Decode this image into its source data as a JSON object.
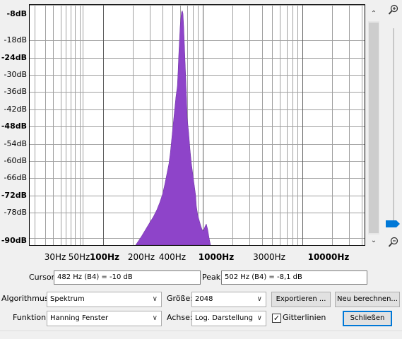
{
  "spectrum": {
    "y_axis": {
      "labels": [
        {
          "text": "-8dB",
          "bold": true
        },
        {
          "text": "-18dB",
          "bold": false
        },
        {
          "text": "-24dB",
          "bold": true
        },
        {
          "text": "-30dB",
          "bold": false
        },
        {
          "text": "-36dB",
          "bold": false
        },
        {
          "text": "-42dB",
          "bold": false
        },
        {
          "text": "-48dB",
          "bold": true
        },
        {
          "text": "-54dB",
          "bold": false
        },
        {
          "text": "-60dB",
          "bold": false
        },
        {
          "text": "-66dB",
          "bold": false
        },
        {
          "text": "-72dB",
          "bold": true
        },
        {
          "text": "-78dB",
          "bold": false
        },
        {
          "text": "-90dB",
          "bold": true
        }
      ]
    },
    "x_axis": {
      "labels": [
        {
          "text": "30Hz",
          "bold": false
        },
        {
          "text": "50Hz",
          "bold": false
        },
        {
          "text": "100Hz",
          "bold": true
        },
        {
          "text": "200Hz",
          "bold": false
        },
        {
          "text": "400Hz",
          "bold": false
        },
        {
          "text": "1000Hz",
          "bold": true
        },
        {
          "text": "3000Hz",
          "bold": false
        },
        {
          "text": "10000Hz",
          "bold": true
        }
      ]
    },
    "scale": "log",
    "grid": true,
    "fill_color": "#8e44c9",
    "peak_frequency_hz": 502,
    "peak_db": -8.1
  },
  "side_controls": {
    "zoom_in_icon": "magnify-plus-icon",
    "zoom_out_icon": "magnify-minus-icon",
    "scroll_up_icon": "chevron-up-icon",
    "scroll_down_icon": "chevron-down-icon",
    "slider_color": "#0078d7"
  },
  "readout": {
    "cursor_label": "Cursor:",
    "cursor_value": "482 Hz (B4) = -10 dB",
    "peak_label": "Peak:",
    "peak_value": "502 Hz (B4) = -8,1 dB"
  },
  "settings": {
    "algorithm_label": "Algorithmus:",
    "algorithm_value": "Spektrum",
    "size_label": "Größe:",
    "size_value": "2048",
    "export_button": "Exportieren ...",
    "recalc_button": "Neu berechnen...",
    "function_label": "Funktion:",
    "function_value": "Hanning Fenster",
    "axis_label": "Achse:",
    "axis_value": "Log. Darstellung",
    "grid_checkbox_label": "Gitterlinien",
    "grid_checked": true,
    "close_button": "Schließen"
  }
}
